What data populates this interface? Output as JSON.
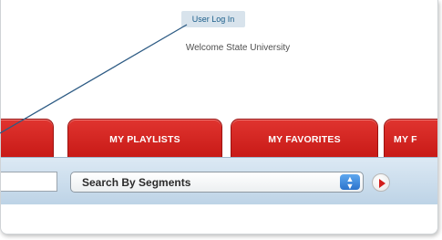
{
  "header": {
    "login_label": "User Log In",
    "welcome_text": "Welcome State University"
  },
  "tabs": [
    {
      "label": ""
    },
    {
      "label": "MY PLAYLISTS"
    },
    {
      "label": "MY FAVORITES"
    },
    {
      "label": "MY F"
    }
  ],
  "search": {
    "text_value": "",
    "select_value": "Search By Segments"
  },
  "colors": {
    "tab_red": "#d8261f",
    "searchbar_blue": "#c9dcec",
    "login_bg": "#d8e3ec"
  },
  "icons": {
    "select_arrows": "up-down-arrows-icon",
    "go": "play-arrow-icon"
  }
}
